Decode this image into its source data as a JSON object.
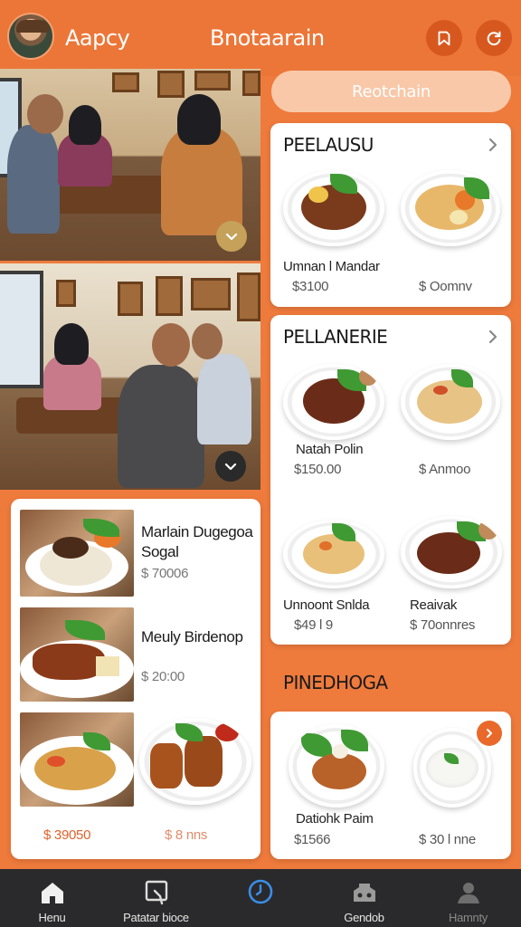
{
  "header": {
    "app_name": "Aapcy",
    "title": "Bnotaarain",
    "avatar_icon": "user-avatar",
    "actions": [
      {
        "name": "bookmark-icon"
      },
      {
        "name": "refresh-icon"
      }
    ]
  },
  "search": {
    "label": "Reotchain"
  },
  "sections": [
    {
      "title": "PEELAUSU",
      "items": [
        {
          "name": "Umnan l Mandar",
          "price": "$3100"
        },
        {
          "name": "",
          "price": "$ Oomnv"
        }
      ]
    },
    {
      "title": "PELLANERIE",
      "items": [
        {
          "name": "Natah Polin",
          "price": "$150.00"
        },
        {
          "name": "",
          "price": "$ Anmoo"
        },
        {
          "name": "Unnoont Snlda",
          "price": "$49 l 9"
        },
        {
          "name": "Reaivak",
          "price": "$ 70onnres"
        }
      ]
    },
    {
      "title": "PINEDHOGA",
      "items": [
        {
          "name": "Datiohk Paim",
          "price": "$1566"
        },
        {
          "name": "",
          "price": "$ 30 l nne"
        }
      ]
    }
  ],
  "left_list": {
    "items": [
      {
        "title_line1": "Marlain Dugegoa",
        "title_line2": "Sogal",
        "price": "$ 70006"
      },
      {
        "title_line1": "Meuly Birdenop",
        "title_line2": "",
        "price": "$ 20:00"
      }
    ],
    "bottom_prices": [
      "$ 39050",
      "$ 8 nns"
    ]
  },
  "bottom_nav": [
    {
      "label": "Henu",
      "icon": "home-icon",
      "active": true
    },
    {
      "label": "Patatar bioce",
      "icon": "search-icon",
      "active": false
    },
    {
      "label": "",
      "icon": "clock-icon",
      "active": false
    },
    {
      "label": "Gendob",
      "icon": "game-icon",
      "active": false
    },
    {
      "label": "Hamnty",
      "icon": "profile-icon",
      "active": false
    }
  ],
  "colors": {
    "brand": "#ec7638",
    "accent": "#e8692a",
    "nav_background": "#2a2a2c"
  }
}
